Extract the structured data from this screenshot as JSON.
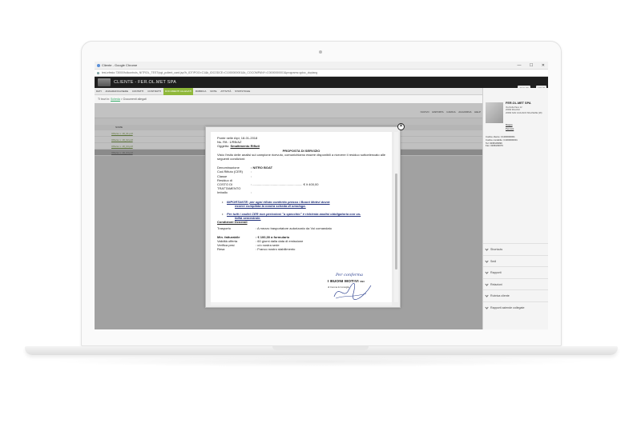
{
  "browser": {
    "window_title": "Cliente - Google Chrome",
    "url": "test-efesto:73000/fullcontrols_NITROL_TEST/pgt_pclient_card.jsp?k_IDTIPOO=C1&k_IDCODCE=C1000000001&k_COCOMPANY=C0000000001&programs=gdoc_doplang",
    "controls": [
      "—",
      "☐",
      "✕"
    ]
  },
  "app": {
    "title": "CLIENTE - FER.OL.MET SPA",
    "header_buttons": [
      "CHIUDI",
      "HELP"
    ],
    "menu": [
      "DATI",
      "ANAGRAFICA/SEDE",
      "CONTATTI",
      "CONTRATTI",
      "DOCUMENTI ALLEGATI",
      "RUBRICA",
      "NOTE",
      "ATTIVITÀ",
      "STATISTICHE"
    ],
    "active_menu_index": 4
  },
  "breadcrumb": {
    "prefix": "Ti trovi in:",
    "link": "Scheda",
    "separator": ">",
    "current": "Documenti allegati"
  },
  "toolbar": {
    "actions": [
      "NUOVO",
      "ESPORTA",
      "CARICA",
      "AGGIORNA",
      "HELP"
    ]
  },
  "tabs": [
    "ALLEGATI",
    "RICERCA"
  ],
  "grid": {
    "header": "NOME",
    "rows": [
      "Offerta n. 18_01.pdf",
      "Offerta n. 18_02.pdf",
      "Offerta n. 18_03.pdf",
      "Offerta n. 18_04.pdf"
    ],
    "selected_row_index": 3
  },
  "sidebar": {
    "company_name": "FER.OL.MET SPA",
    "address_lines": [
      "Via Della Pace 12",
      "20090 MILANO",
      "20090 SAN GIULIANO MILANESE (MI)"
    ],
    "links": [
      "Mappa",
      "Percorsi"
    ],
    "codes": [
      "Codice cliente: C1000000001",
      "Codice contabile: C1000000001",
      "Tel: 0298139999",
      "Fax: 0298139979"
    ],
    "sections": [
      "Shortcuts",
      "Sedi",
      "Rapporti",
      "Relazioni",
      "Rubrica cliente",
      "Rapporti aziende collegate"
    ]
  },
  "document": {
    "date_line": "Ponte nelle Alpi, 18-01-2018",
    "ref_line": "Ns. Rif.: 1/RB/AZ",
    "subject_label": "Oggetto:",
    "subject_value": "Smaltimento Rifiuti",
    "title": "PROPOSTA DI SERVIZIO",
    "intro": "Visto l'esito delle analisi sul campione ricevuto, comunichiamo essere disponibili a ricevere il residuo sottoelencato alle seguenti condizioni:",
    "fields": [
      {
        "label": "Denominazione",
        "value": ": NITRO BOAT"
      },
      {
        "label": "Cod.Rifiuto (CER)",
        "value": ":"
      },
      {
        "label": "Classe",
        "value": ":"
      },
      {
        "label": "Residuo di",
        "value": ""
      },
      {
        "label": "COSTO DI TRATTAMENTO",
        "value": ": ........................................................ € /t    400,00"
      },
      {
        "label": "Imballo",
        "value": ":"
      }
    ],
    "bullet1_label": "IMPORTANTE:",
    "bullet1_text": "per ogni rifiuto conferito presso i Buoni Motivi dovrà",
    "bullet1_sub": "essere compilata la nostra scheda di omologa.",
    "bullet2_text": "Per tutti i codici CER non pericolosi \"a specchio\" è richiesta analisi obbligatoria con va-",
    "bullet2_sub": "lidità semestrale.",
    "conditions_title": "Condizioni Generali",
    "transport_label": "Trasporto",
    "transport_value": ":   A mezzo trasportatore autorizzato da Voi comandato",
    "terms": [
      {
        "label": "Min. fatturabile",
        "value": ":   € 100,00 a formulario",
        "bold": true
      },
      {
        "label": "Validità offerta",
        "value": ":   60   giorni dalla data di emissione",
        "bold": false
      },
      {
        "label": "Verifica pesi",
        "value": ":   c/o nostra sede",
        "bold": false
      },
      {
        "label": "Resa",
        "value": ":   Franco nostro stabilimento",
        "bold": false
      }
    ],
    "signature_script": "Per conferma",
    "signature_stamp": "I BUONI MOTIVI",
    "signature_stamp_suffix": "SNC",
    "signature_sub": "di Corona & Consiglio"
  },
  "colors": {
    "accent": "#8fb83a",
    "header_bg": "#1e1e1e",
    "doc_bullet_text": "#1f2f7a"
  }
}
